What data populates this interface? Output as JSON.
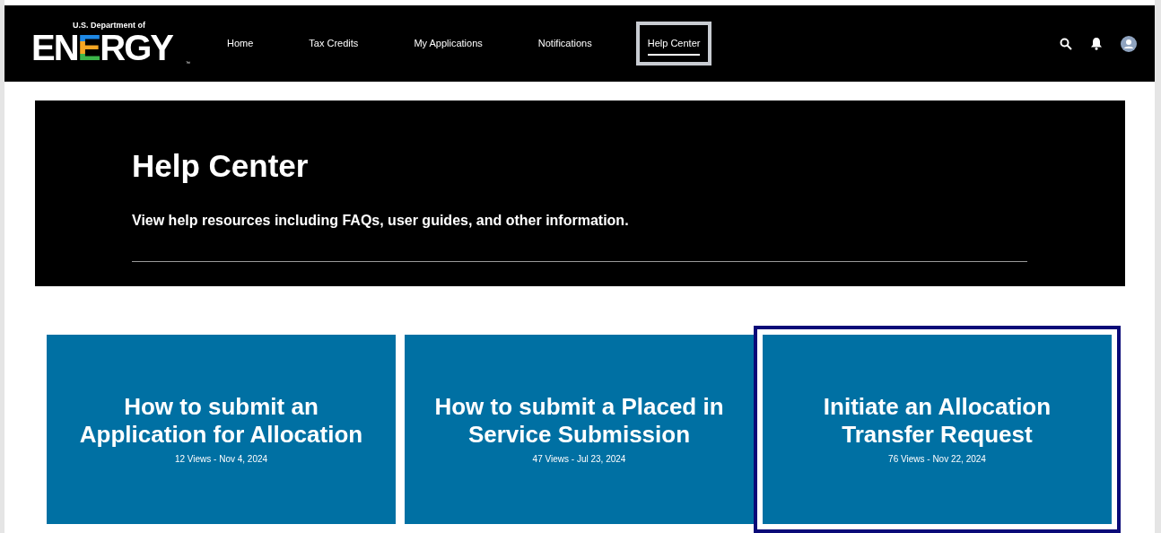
{
  "logo": {
    "agency": "U.S. Department of",
    "wordmark": "ENERGY",
    "trademark": "™"
  },
  "nav": [
    {
      "label": "Home",
      "selected": false
    },
    {
      "label": "Tax Credits",
      "selected": false
    },
    {
      "label": "My Applications",
      "selected": false
    },
    {
      "label": "Notifications",
      "selected": false
    },
    {
      "label": "Help Center",
      "selected": true
    }
  ],
  "hero": {
    "title": "Help Center",
    "subtitle": "View help resources including FAQs, user guides, and other information."
  },
  "cards": [
    {
      "title": "How to submit an Application for Allocation",
      "meta": "12 Views - Nov 4, 2024",
      "focused": false
    },
    {
      "title": "How to submit a Placed in Service Submission",
      "meta": "47 Views - Jul 23, 2024",
      "focused": false
    },
    {
      "title": "Initiate an Allocation Transfer Request",
      "meta": "76 Views - Nov 22, 2024",
      "focused": true
    }
  ]
}
